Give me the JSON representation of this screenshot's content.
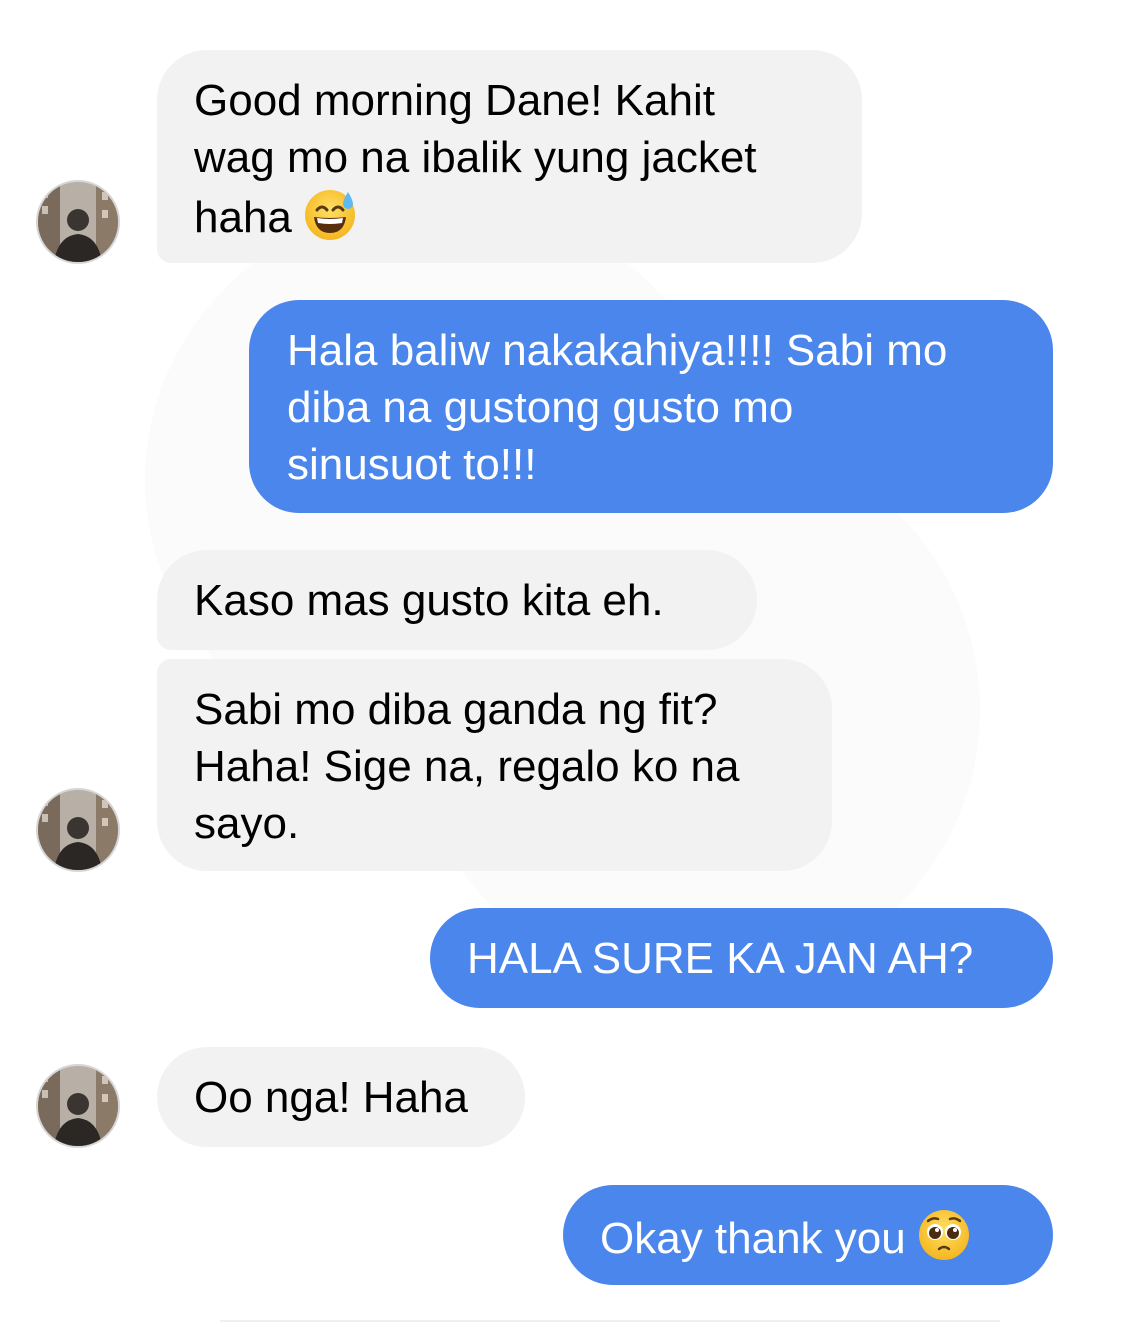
{
  "conversation": {
    "messages": [
      {
        "sender": "them",
        "lines": [
          "Good morning Dane! Kahit",
          "wag mo na ibalik yung jacket",
          "haha"
        ],
        "emoji": "sweat-smile-emoji"
      },
      {
        "sender": "me",
        "lines": [
          "Hala baliw nakakahiya!!!! Sabi mo",
          "diba na gustong gusto mo",
          "sinusuot to!!!"
        ]
      },
      {
        "sender": "them",
        "lines": [
          "Kaso mas gusto kita eh."
        ]
      },
      {
        "sender": "them",
        "lines": [
          "Sabi mo diba ganda ng fit?",
          "Haha! Sige na, regalo ko na",
          "sayo."
        ]
      },
      {
        "sender": "me",
        "lines": [
          "HALA SURE KA JAN AH?"
        ]
      },
      {
        "sender": "them",
        "lines": [
          "Oo nga! Haha"
        ]
      },
      {
        "sender": "me",
        "lines": [
          "Okay thank you"
        ],
        "emoji": "pleading-face-emoji"
      }
    ]
  },
  "colors": {
    "incoming_bubble": "#f2f2f2",
    "outgoing_bubble": "#4a86ec",
    "incoming_text": "#000000",
    "outgoing_text": "#ffffff"
  }
}
